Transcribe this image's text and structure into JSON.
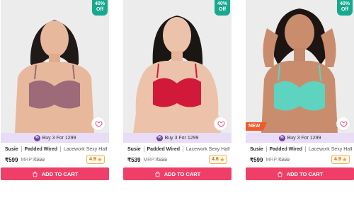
{
  "products": [
    {
      "discount_line1": "40%",
      "discount_line2": "Off",
      "new_tag": "",
      "offer": "Buy 3 For 1299",
      "brand": "Susie",
      "tag": "Padded Wired",
      "desc": "Lacework Sexy Half Cov...",
      "price": "₹599",
      "mrp_label": "MRP:",
      "mrp": "₹999",
      "rating": "4.9",
      "bra_color": "#9c6a78",
      "cart_label": "ADD TO CART"
    },
    {
      "discount_line1": "40%",
      "discount_line2": "Off",
      "new_tag": "",
      "offer": "Buy 3 For 1299",
      "brand": "Susie",
      "tag": "Padded Wired",
      "desc": "Lacework Sexy Half Cov...",
      "price": "₹539",
      "mrp_label": "MRP:",
      "mrp": "₹899",
      "rating": "4.6",
      "bra_color": "#d11a3a",
      "cart_label": "ADD TO CART"
    },
    {
      "discount_line1": "40%",
      "discount_line2": "Off",
      "new_tag": "NEW",
      "offer": "Buy 3 For 1299",
      "brand": "Susie",
      "tag": "Padded Wired",
      "desc": "Lacework Sexy Half Cov...",
      "price": "₹599",
      "mrp_label": "MRP:",
      "mrp": "₹999",
      "rating": "4.9",
      "bra_color": "#5ed3bf",
      "cart_label": "ADD TO CART"
    }
  ],
  "colors": {
    "discount_badge": "#16a98f",
    "offer_bar": "#e9dcf6",
    "cart_button": "#ef3f68",
    "new_tag": "#f05a2b"
  },
  "icons": {
    "offer": "offer-percent-icon",
    "wishlist": "heart-icon",
    "cart": "shopping-bag-icon",
    "rating": "star-icon"
  }
}
